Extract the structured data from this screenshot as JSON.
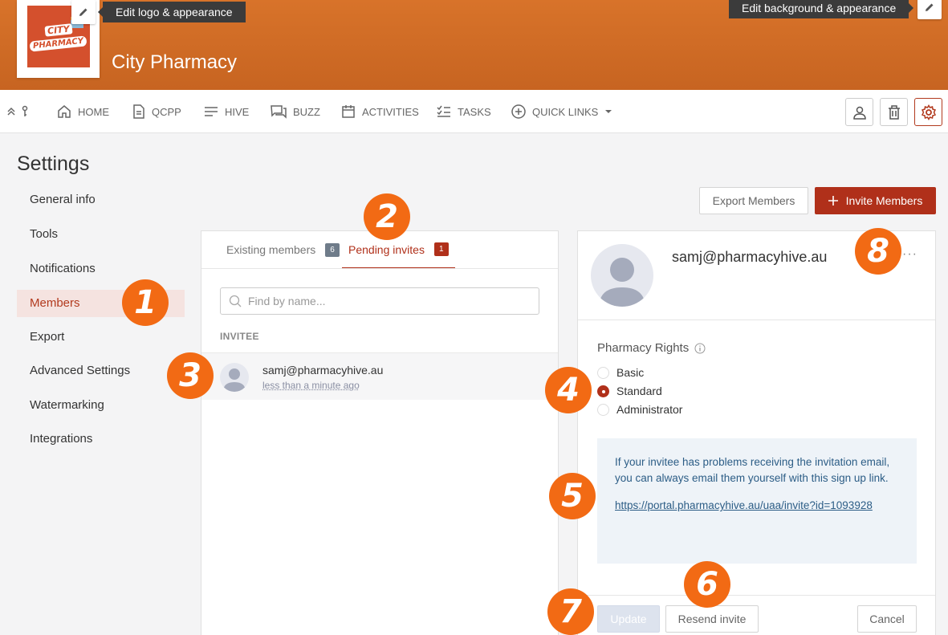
{
  "header": {
    "logo": {
      "line1": "CITY",
      "line2": "PHARMACY"
    },
    "edit_logo_tooltip": "Edit logo & appearance",
    "edit_background_tooltip": "Edit background & appearance",
    "org_name": "City Pharmacy"
  },
  "nav": {
    "items": [
      {
        "label": "HOME",
        "icon": "home-icon"
      },
      {
        "label": "QCPP",
        "icon": "document-icon"
      },
      {
        "label": "HIVE",
        "icon": "lines-icon"
      },
      {
        "label": "BUZZ",
        "icon": "chat-icon"
      },
      {
        "label": "ACTIVITIES",
        "icon": "calendar-icon"
      },
      {
        "label": "TASKS",
        "icon": "checklist-icon"
      },
      {
        "label": "QUICK LINKS",
        "icon": "plus-circle-icon"
      }
    ]
  },
  "settings": {
    "title": "Settings",
    "sidebar": [
      {
        "label": "General info"
      },
      {
        "label": "Tools"
      },
      {
        "label": "Notifications"
      },
      {
        "label": "Members"
      },
      {
        "label": "Export"
      },
      {
        "label": "Advanced Settings"
      },
      {
        "label": "Watermarking"
      },
      {
        "label": "Integrations"
      }
    ],
    "active_item": "Members"
  },
  "actions": {
    "export_label": "Export Members",
    "invite_label": "Invite Members"
  },
  "members": {
    "tabs": [
      {
        "label": "Existing members",
        "count": "6"
      },
      {
        "label": "Pending invites",
        "count": "1"
      }
    ],
    "search_placeholder": "Find by name...",
    "column_header": "INVITEE",
    "rows": [
      {
        "email": "samj@pharmacyhive.au",
        "time": "less than a minute ago"
      }
    ]
  },
  "detail": {
    "email": "samj@pharmacyhive.au",
    "more_label": "···",
    "rights_label": "Pharmacy Rights",
    "rights_options": [
      {
        "label": "Basic",
        "selected": false
      },
      {
        "label": "Standard",
        "selected": true
      },
      {
        "label": "Administrator",
        "selected": false
      }
    ],
    "info_text": "If your invitee has problems receiving the invitation email, you can always email them yourself with this sign up link.",
    "invite_link": "https://portal.pharmacyhive.au/uaa/invite?id=1093928",
    "update_label": "Update",
    "resend_label": "Resend invite",
    "cancel_label": "Cancel"
  },
  "annotations": [
    "1",
    "2",
    "3",
    "4",
    "5",
    "6",
    "7",
    "8"
  ],
  "colors": {
    "header": "#c96a25",
    "primary": "#b0301a",
    "annotation": "#f26a14",
    "info_bg": "#eef3f8"
  }
}
